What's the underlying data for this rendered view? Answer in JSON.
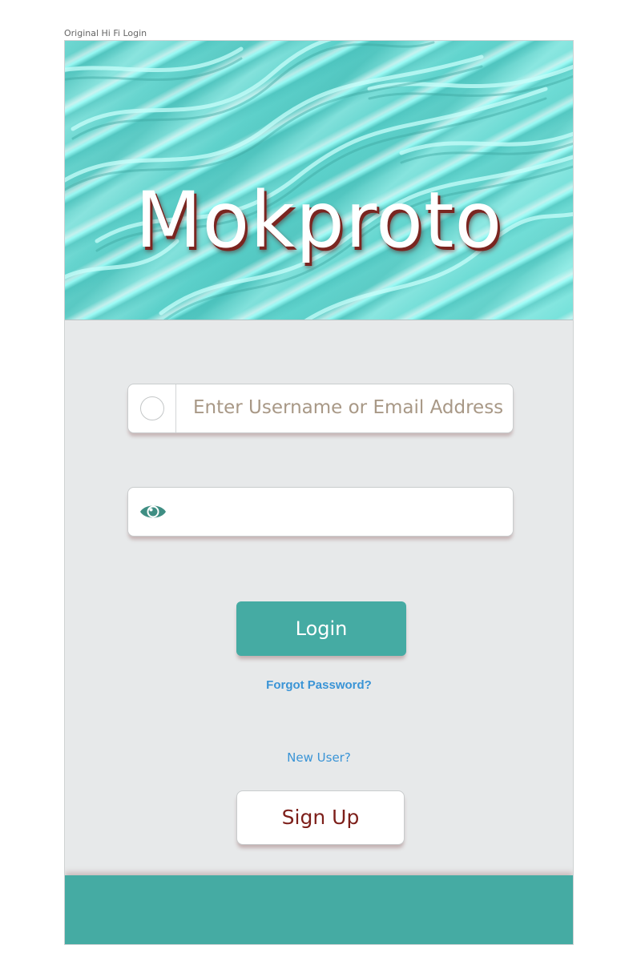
{
  "frame": {
    "label": "Original Hi Fi Login"
  },
  "hero": {
    "brand": "Mokproto"
  },
  "form": {
    "username": {
      "placeholder": "Enter Username or Email Address",
      "value": "",
      "icon": "radio-circle-icon"
    },
    "password": {
      "placeholder": "",
      "value": "",
      "icon": "eye-icon"
    }
  },
  "actions": {
    "login_label": "Login",
    "forgot_label": "Forgot Password?",
    "new_user_label": "New User?",
    "signup_label": "Sign Up"
  },
  "colors": {
    "accent": "#45aba3",
    "link": "#3a94d6",
    "signup_text": "#7d1f1a",
    "placeholder": "#a89886",
    "background": "#e7e9ea"
  }
}
